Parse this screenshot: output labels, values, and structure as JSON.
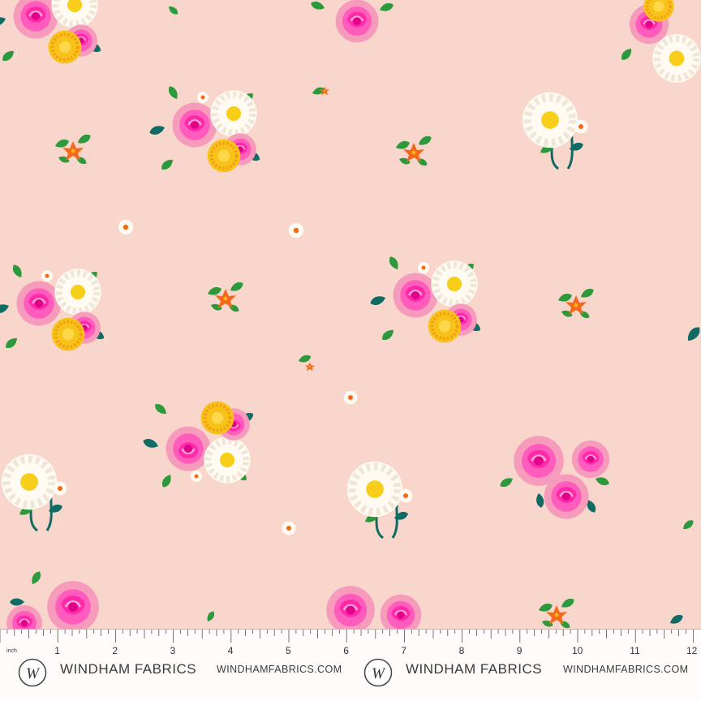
{
  "fabric": {
    "background_color": "#f9d6cb",
    "motifs": [
      "pink-rose",
      "white-daisy",
      "yellow-dahlia",
      "orange-blossom",
      "green-leaf"
    ],
    "colors": {
      "rose": "#ff3fb4",
      "rose_petal": "#f77fb6",
      "daisy": "#fdf6ea",
      "dahlia": "#f7c21a",
      "blossom": "#f26a19",
      "leaf": "#2c9a3c",
      "leaf_dark": "#0f6b63"
    }
  },
  "ruler": {
    "unit_label": "inch",
    "ticks": [
      "1",
      "2",
      "3",
      "4",
      "5",
      "6",
      "7",
      "8",
      "9",
      "10",
      "11",
      "12"
    ]
  },
  "branding": {
    "brand_name_left": "WINDHAM FABRICS",
    "url_left": "WINDHAMFABRICS.COM",
    "brand_name_right": "WINDHAM FABRICS",
    "url_right": "WINDHAMFABRICS.COM",
    "logo_letter": "W"
  }
}
